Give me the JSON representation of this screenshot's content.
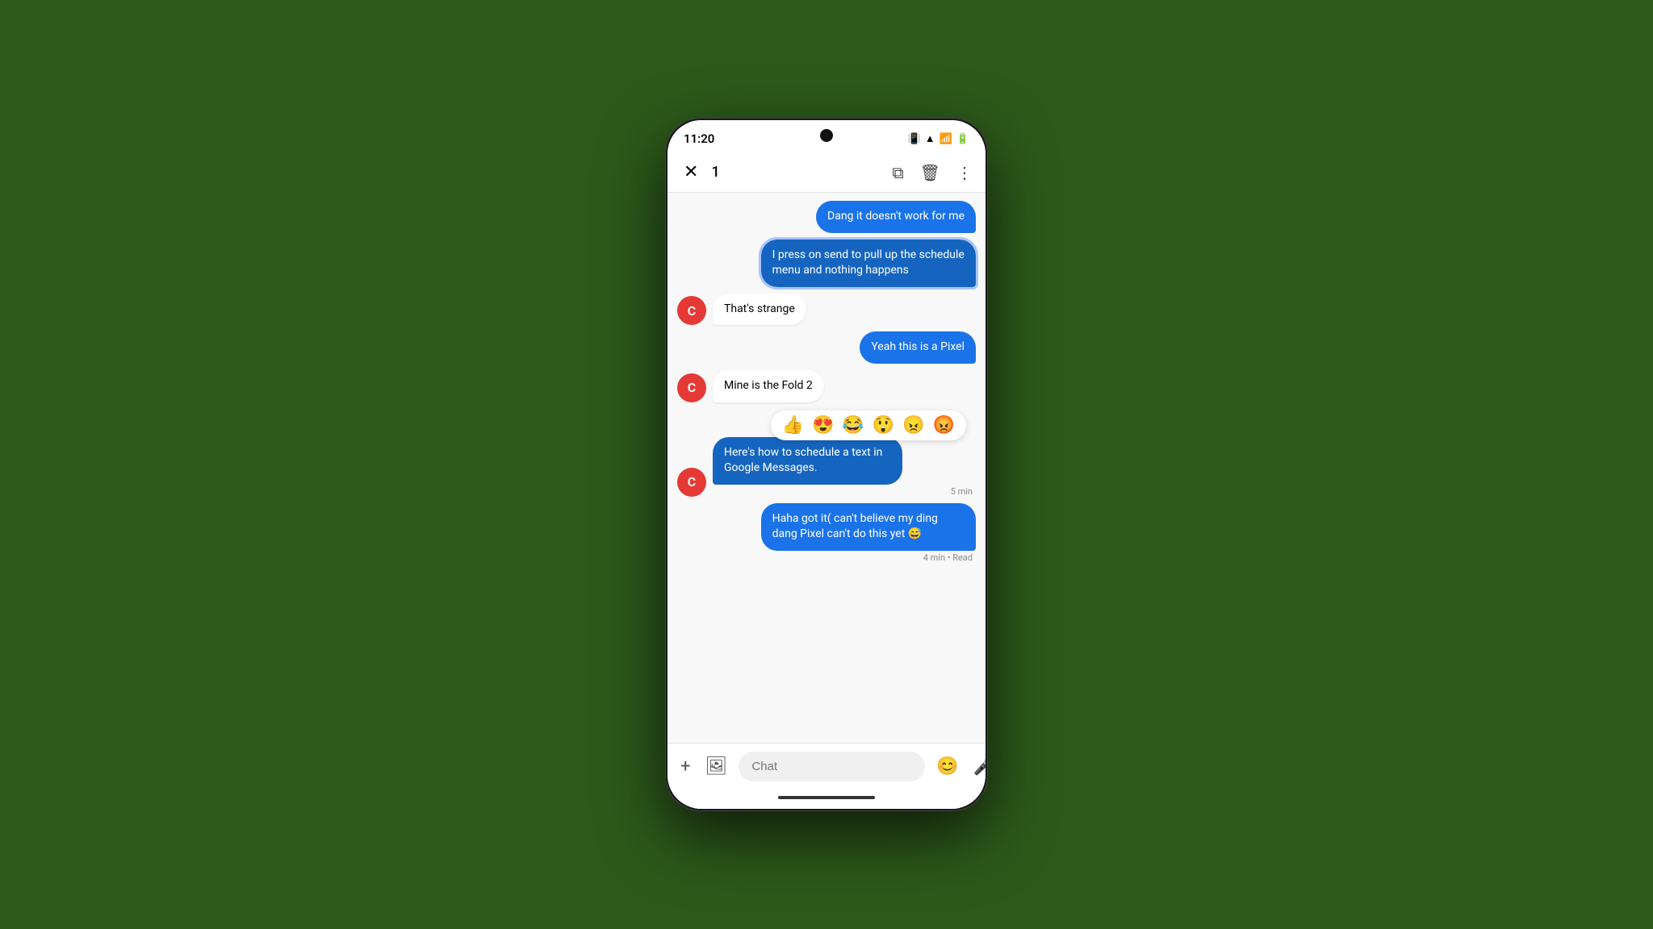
{
  "status": {
    "time": "11:20",
    "battery": "🔋",
    "signal": "📶"
  },
  "actionBar": {
    "count": "1",
    "close": "✕",
    "copy_icon": "⧉",
    "delete_icon": "🗑",
    "more_icon": "⋮"
  },
  "messages": [
    {
      "id": "msg1",
      "type": "sent",
      "text": "Dang it doesn't work for me",
      "timestamp": ""
    },
    {
      "id": "msg2",
      "type": "sent",
      "text": "I press on send to pull up the schedule menu and nothing happens",
      "timestamp": "",
      "selected": true
    },
    {
      "id": "msg3",
      "type": "received",
      "avatar": "C",
      "text": "That's strange",
      "timestamp": ""
    },
    {
      "id": "msg4",
      "type": "sent",
      "text": "Yeah this is a Pixel",
      "timestamp": ""
    },
    {
      "id": "msg5",
      "type": "received",
      "avatar": "C",
      "text": "Mine is the Fold 2",
      "timestamp": ""
    },
    {
      "id": "msg6",
      "type": "received_blue",
      "avatar": "C",
      "text": "Here's how to schedule a text in Google Messages.",
      "timestamp": "5 min"
    },
    {
      "id": "msg7",
      "type": "sent",
      "text": "Haha got it( can't believe my ding dang Pixel can't do this yet 😅",
      "timestamp": "4 min • Read"
    }
  ],
  "reactions": {
    "emojis": [
      "👍",
      "😍",
      "😂",
      "😲",
      "😠",
      "😡"
    ]
  },
  "inputBar": {
    "placeholder": "Chat",
    "add_icon": "+",
    "image_icon": "🖼",
    "emoji_icon": "😊",
    "mic_icon": "🎤"
  }
}
